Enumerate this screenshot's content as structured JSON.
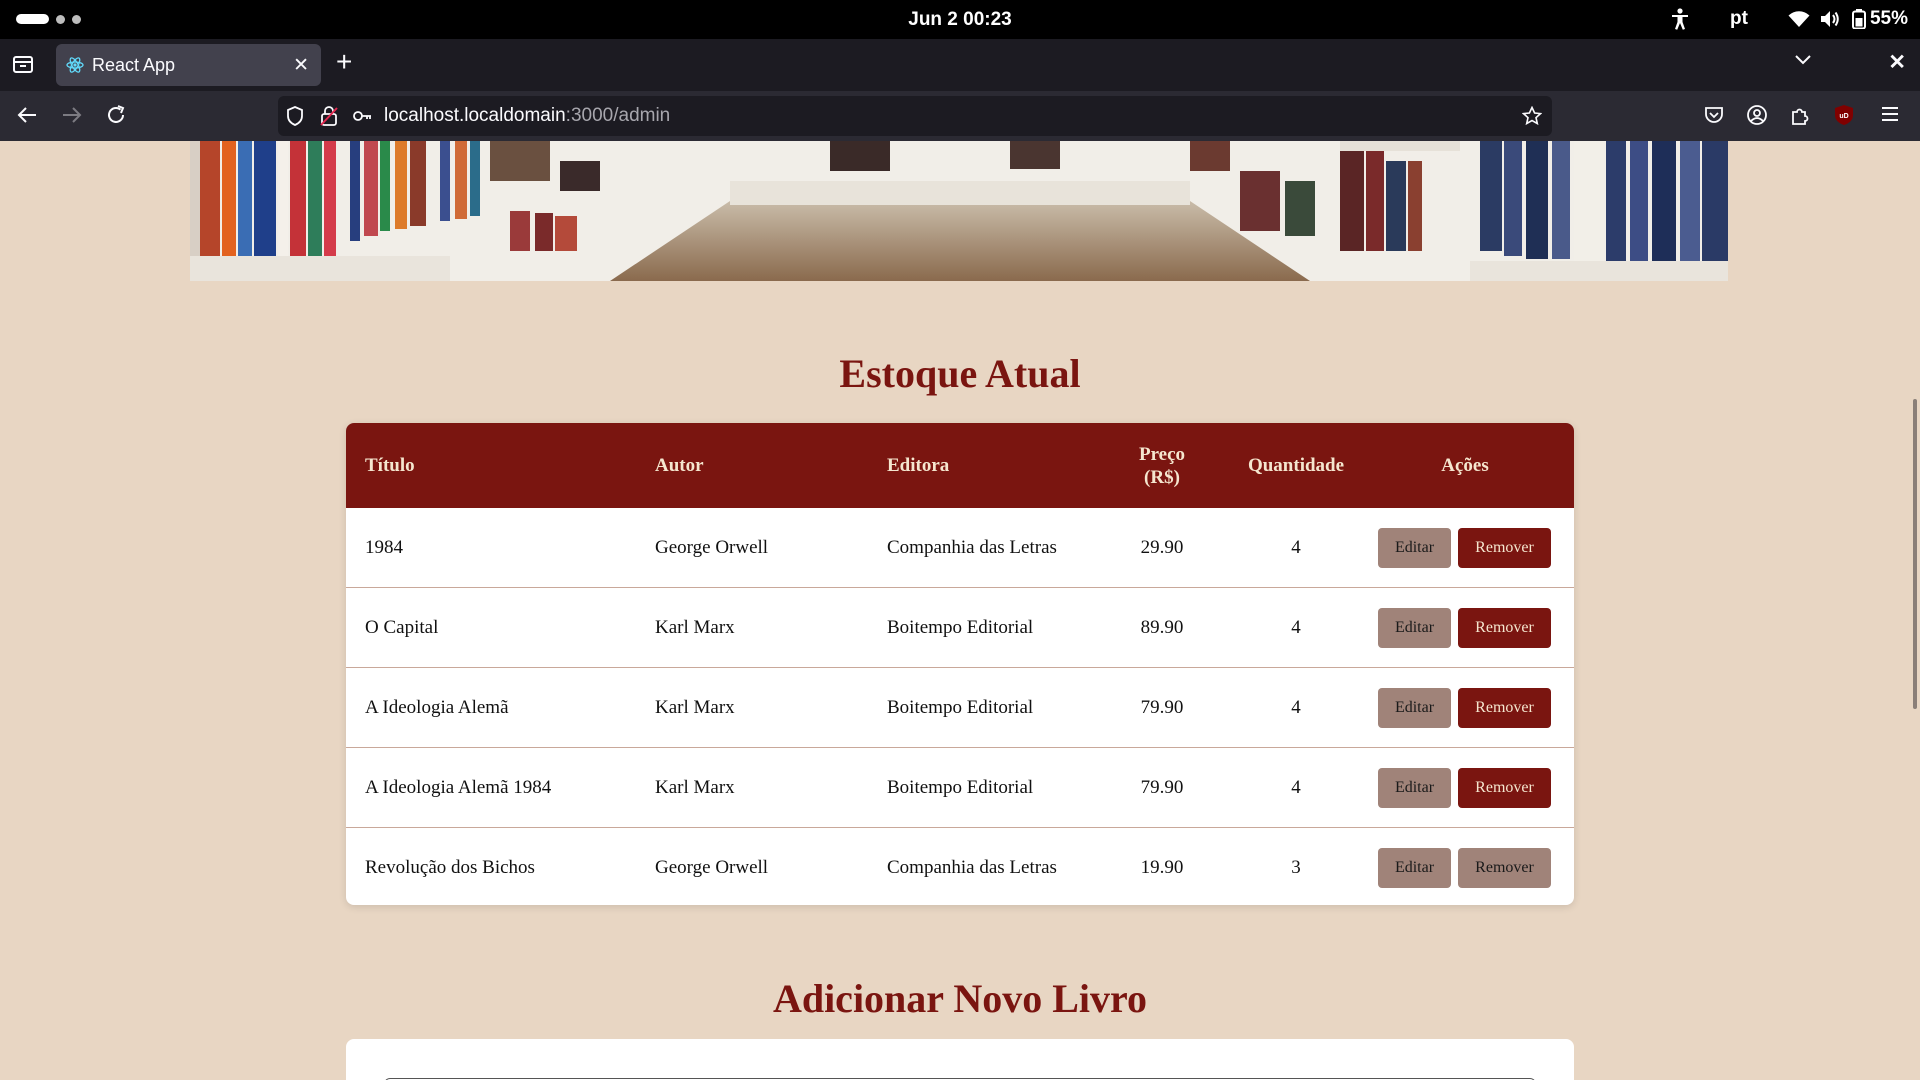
{
  "system": {
    "clock": "Jun 2  00:23",
    "language": "pt",
    "battery": "55%"
  },
  "browser": {
    "tab_title": "React App",
    "url_host": "localhost.localdomain",
    "url_path": ":3000/admin"
  },
  "stock": {
    "heading": "Estoque Atual",
    "columns": {
      "title": "Título",
      "author": "Autor",
      "publisher": "Editora",
      "price_line1": "Preço",
      "price_line2": "(R$)",
      "quantity": "Quantidade",
      "actions": "Ações"
    },
    "edit_label": "Editar",
    "remove_label": "Remover",
    "rows": [
      {
        "title": "1984",
        "author": "George Orwell",
        "publisher": "Companhia das Letras",
        "price": "29.90",
        "quantity": "4"
      },
      {
        "title": "O Capital",
        "author": "Karl Marx",
        "publisher": "Boitempo Editorial",
        "price": "89.90",
        "quantity": "4"
      },
      {
        "title": "A Ideologia Alemã",
        "author": "Karl Marx",
        "publisher": "Boitempo Editorial",
        "price": "79.90",
        "quantity": "4"
      },
      {
        "title": "A Ideologia Alemã 1984",
        "author": "Karl Marx",
        "publisher": "Boitempo Editorial",
        "price": "79.90",
        "quantity": "4"
      },
      {
        "title": "Revolução dos Bichos",
        "author": "George Orwell",
        "publisher": "Companhia das Letras",
        "price": "19.90",
        "quantity": "3"
      }
    ]
  },
  "add_book": {
    "heading": "Adicionar Novo Livro"
  },
  "colors": {
    "page_background": "#e8d6c3",
    "accent": "#7a1510",
    "secondary_button": "#a08379"
  }
}
